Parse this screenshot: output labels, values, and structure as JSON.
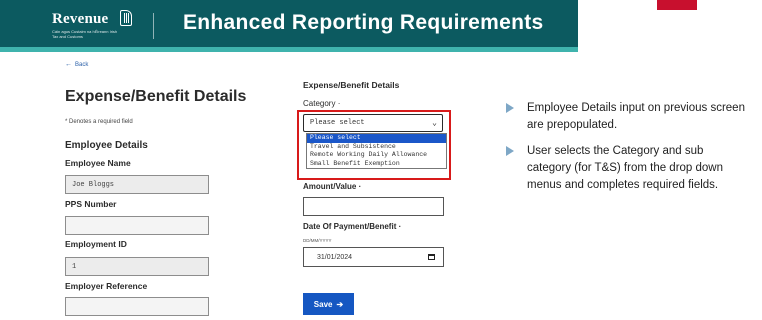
{
  "header": {
    "logo_word": "Revenue",
    "logo_sub": "Cáin agus Custaim na hÉireann Irish Tax and Customs",
    "title": "Enhanced Reporting Requirements"
  },
  "nav": {
    "back_label": "Back"
  },
  "left": {
    "page_title": "Expense/Benefit Details",
    "required_note": "* Denotes a required field",
    "section_title": "Employee Details",
    "employee_name_label": "Employee Name",
    "employee_name_value": "Joe Bloggs",
    "pps_label": "PPS Number",
    "pps_value": "",
    "employment_id_label": "Employment ID",
    "employment_id_value": "1",
    "employer_ref_label": "Employer Reference",
    "employer_ref_value": ""
  },
  "form": {
    "section_title": "Expense/Benefit Details",
    "category_label": "Category",
    "category_selected": "Please select",
    "category_options": [
      "Please select",
      "Travel and Subsistence",
      "Remote Working Daily Allowance",
      "Small Benefit Exemption"
    ],
    "amount_label": "Amount/Value",
    "date_label": "Date Of Payment/Benefit",
    "date_hint": "DD/MM/YYYY",
    "date_value": "31/01/2024",
    "save_label": "Save"
  },
  "notes": [
    "Employee Details input on previous screen are prepopulated.",
    "User selects the Category and sub category (for T&S) from the drop down menus and completes required fields."
  ],
  "colors": {
    "header_bg": "#0c5a60",
    "header_stripe": "#3fb3ad",
    "highlight": "#d81a1a",
    "button": "#1557c2",
    "bullet": "#7ea7c6"
  }
}
